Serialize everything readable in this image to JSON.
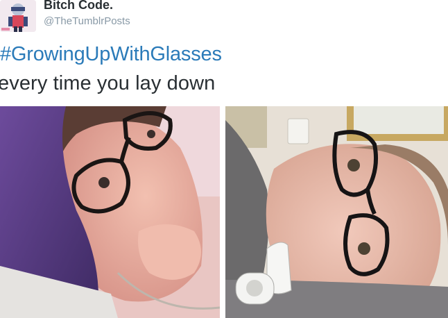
{
  "tweet": {
    "display_name": "Bitch Code.",
    "handle": "@TheTumblrPosts",
    "hashtag": "#GrowingUpWithGlasses",
    "text": "every time you lay down"
  },
  "media": [
    {
      "description": "selfie-lying-on-pillow-glasses-tilted"
    },
    {
      "description": "selfie-head-on-arm-glasses-sideways"
    }
  ],
  "colors": {
    "link": "#2b7bb9",
    "name": "#292f33",
    "handle": "#8899a6"
  }
}
